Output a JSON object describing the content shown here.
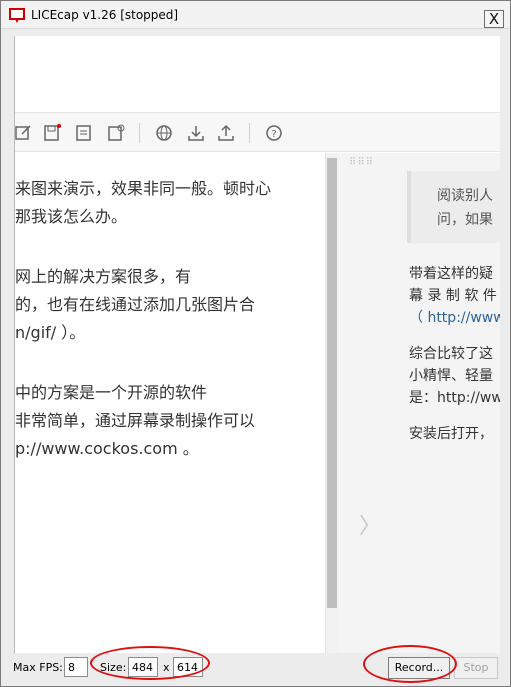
{
  "window": {
    "title": "LICEcap v1.26 [stopped]",
    "close_glyph": "X"
  },
  "editor": {
    "lines": [
      "来图来演示，效果非同一般。顿时心",
      "那我该怎么办。",
      "",
      "网上的解决方案很多，有",
      "的，也有在线通过添加几张图片合",
      "n/gif/ ）。",
      "",
      "中的方案是一个开源的软件",
      "非常简单，通过屏幕录制操作可以",
      "p://www.cockos.com 。"
    ]
  },
  "preview": {
    "quote_lines": [
      "阅读别人",
      "问，如果"
    ],
    "lines": [
      "带着这样的疑",
      "幕 录 制 软 件",
      "（ http://www",
      "",
      "综合比较了这",
      "小精悍、轻量",
      "是：http://ww",
      "",
      "安装后打开，"
    ]
  },
  "status": {
    "max_fps_label": "Max FPS:",
    "max_fps_value": "8",
    "size_label": "Size:",
    "width_value": "484",
    "x_label": "x",
    "height_value": "614",
    "record_label": "Record...",
    "stop_label": "Stop"
  },
  "colors": {
    "annotation": "#dd1111",
    "link": "#2a6496"
  }
}
